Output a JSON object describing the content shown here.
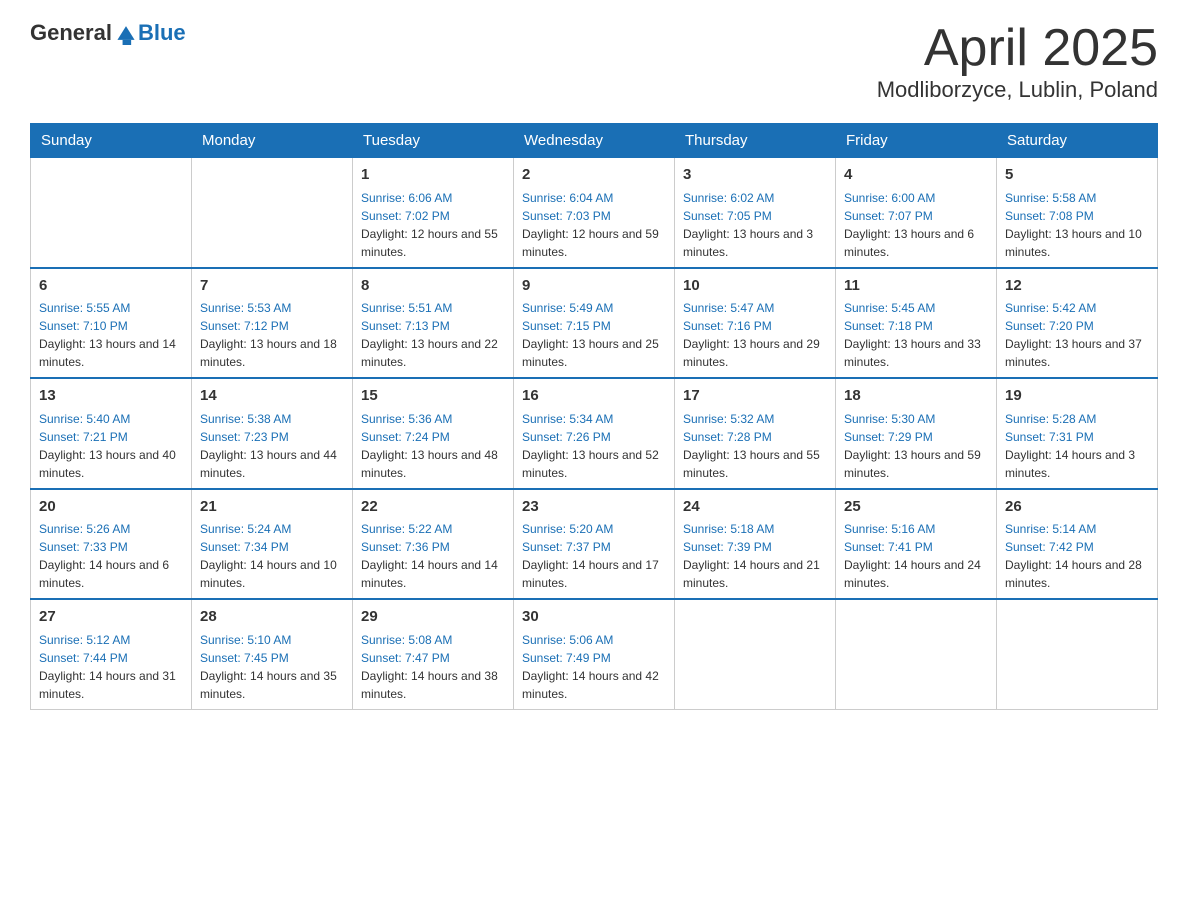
{
  "header": {
    "logo_general": "General",
    "logo_blue": "Blue",
    "month_title": "April 2025",
    "location": "Modliborzyce, Lublin, Poland"
  },
  "days_of_week": [
    "Sunday",
    "Monday",
    "Tuesday",
    "Wednesday",
    "Thursday",
    "Friday",
    "Saturday"
  ],
  "weeks": [
    [
      {
        "day": "",
        "info": ""
      },
      {
        "day": "",
        "info": ""
      },
      {
        "day": "1",
        "sunrise": "Sunrise: 6:06 AM",
        "sunset": "Sunset: 7:02 PM",
        "daylight": "Daylight: 12 hours and 55 minutes."
      },
      {
        "day": "2",
        "sunrise": "Sunrise: 6:04 AM",
        "sunset": "Sunset: 7:03 PM",
        "daylight": "Daylight: 12 hours and 59 minutes."
      },
      {
        "day": "3",
        "sunrise": "Sunrise: 6:02 AM",
        "sunset": "Sunset: 7:05 PM",
        "daylight": "Daylight: 13 hours and 3 minutes."
      },
      {
        "day": "4",
        "sunrise": "Sunrise: 6:00 AM",
        "sunset": "Sunset: 7:07 PM",
        "daylight": "Daylight: 13 hours and 6 minutes."
      },
      {
        "day": "5",
        "sunrise": "Sunrise: 5:58 AM",
        "sunset": "Sunset: 7:08 PM",
        "daylight": "Daylight: 13 hours and 10 minutes."
      }
    ],
    [
      {
        "day": "6",
        "sunrise": "Sunrise: 5:55 AM",
        "sunset": "Sunset: 7:10 PM",
        "daylight": "Daylight: 13 hours and 14 minutes."
      },
      {
        "day": "7",
        "sunrise": "Sunrise: 5:53 AM",
        "sunset": "Sunset: 7:12 PM",
        "daylight": "Daylight: 13 hours and 18 minutes."
      },
      {
        "day": "8",
        "sunrise": "Sunrise: 5:51 AM",
        "sunset": "Sunset: 7:13 PM",
        "daylight": "Daylight: 13 hours and 22 minutes."
      },
      {
        "day": "9",
        "sunrise": "Sunrise: 5:49 AM",
        "sunset": "Sunset: 7:15 PM",
        "daylight": "Daylight: 13 hours and 25 minutes."
      },
      {
        "day": "10",
        "sunrise": "Sunrise: 5:47 AM",
        "sunset": "Sunset: 7:16 PM",
        "daylight": "Daylight: 13 hours and 29 minutes."
      },
      {
        "day": "11",
        "sunrise": "Sunrise: 5:45 AM",
        "sunset": "Sunset: 7:18 PM",
        "daylight": "Daylight: 13 hours and 33 minutes."
      },
      {
        "day": "12",
        "sunrise": "Sunrise: 5:42 AM",
        "sunset": "Sunset: 7:20 PM",
        "daylight": "Daylight: 13 hours and 37 minutes."
      }
    ],
    [
      {
        "day": "13",
        "sunrise": "Sunrise: 5:40 AM",
        "sunset": "Sunset: 7:21 PM",
        "daylight": "Daylight: 13 hours and 40 minutes."
      },
      {
        "day": "14",
        "sunrise": "Sunrise: 5:38 AM",
        "sunset": "Sunset: 7:23 PM",
        "daylight": "Daylight: 13 hours and 44 minutes."
      },
      {
        "day": "15",
        "sunrise": "Sunrise: 5:36 AM",
        "sunset": "Sunset: 7:24 PM",
        "daylight": "Daylight: 13 hours and 48 minutes."
      },
      {
        "day": "16",
        "sunrise": "Sunrise: 5:34 AM",
        "sunset": "Sunset: 7:26 PM",
        "daylight": "Daylight: 13 hours and 52 minutes."
      },
      {
        "day": "17",
        "sunrise": "Sunrise: 5:32 AM",
        "sunset": "Sunset: 7:28 PM",
        "daylight": "Daylight: 13 hours and 55 minutes."
      },
      {
        "day": "18",
        "sunrise": "Sunrise: 5:30 AM",
        "sunset": "Sunset: 7:29 PM",
        "daylight": "Daylight: 13 hours and 59 minutes."
      },
      {
        "day": "19",
        "sunrise": "Sunrise: 5:28 AM",
        "sunset": "Sunset: 7:31 PM",
        "daylight": "Daylight: 14 hours and 3 minutes."
      }
    ],
    [
      {
        "day": "20",
        "sunrise": "Sunrise: 5:26 AM",
        "sunset": "Sunset: 7:33 PM",
        "daylight": "Daylight: 14 hours and 6 minutes."
      },
      {
        "day": "21",
        "sunrise": "Sunrise: 5:24 AM",
        "sunset": "Sunset: 7:34 PM",
        "daylight": "Daylight: 14 hours and 10 minutes."
      },
      {
        "day": "22",
        "sunrise": "Sunrise: 5:22 AM",
        "sunset": "Sunset: 7:36 PM",
        "daylight": "Daylight: 14 hours and 14 minutes."
      },
      {
        "day": "23",
        "sunrise": "Sunrise: 5:20 AM",
        "sunset": "Sunset: 7:37 PM",
        "daylight": "Daylight: 14 hours and 17 minutes."
      },
      {
        "day": "24",
        "sunrise": "Sunrise: 5:18 AM",
        "sunset": "Sunset: 7:39 PM",
        "daylight": "Daylight: 14 hours and 21 minutes."
      },
      {
        "day": "25",
        "sunrise": "Sunrise: 5:16 AM",
        "sunset": "Sunset: 7:41 PM",
        "daylight": "Daylight: 14 hours and 24 minutes."
      },
      {
        "day": "26",
        "sunrise": "Sunrise: 5:14 AM",
        "sunset": "Sunset: 7:42 PM",
        "daylight": "Daylight: 14 hours and 28 minutes."
      }
    ],
    [
      {
        "day": "27",
        "sunrise": "Sunrise: 5:12 AM",
        "sunset": "Sunset: 7:44 PM",
        "daylight": "Daylight: 14 hours and 31 minutes."
      },
      {
        "day": "28",
        "sunrise": "Sunrise: 5:10 AM",
        "sunset": "Sunset: 7:45 PM",
        "daylight": "Daylight: 14 hours and 35 minutes."
      },
      {
        "day": "29",
        "sunrise": "Sunrise: 5:08 AM",
        "sunset": "Sunset: 7:47 PM",
        "daylight": "Daylight: 14 hours and 38 minutes."
      },
      {
        "day": "30",
        "sunrise": "Sunrise: 5:06 AM",
        "sunset": "Sunset: 7:49 PM",
        "daylight": "Daylight: 14 hours and 42 minutes."
      },
      {
        "day": "",
        "info": ""
      },
      {
        "day": "",
        "info": ""
      },
      {
        "day": "",
        "info": ""
      }
    ]
  ]
}
